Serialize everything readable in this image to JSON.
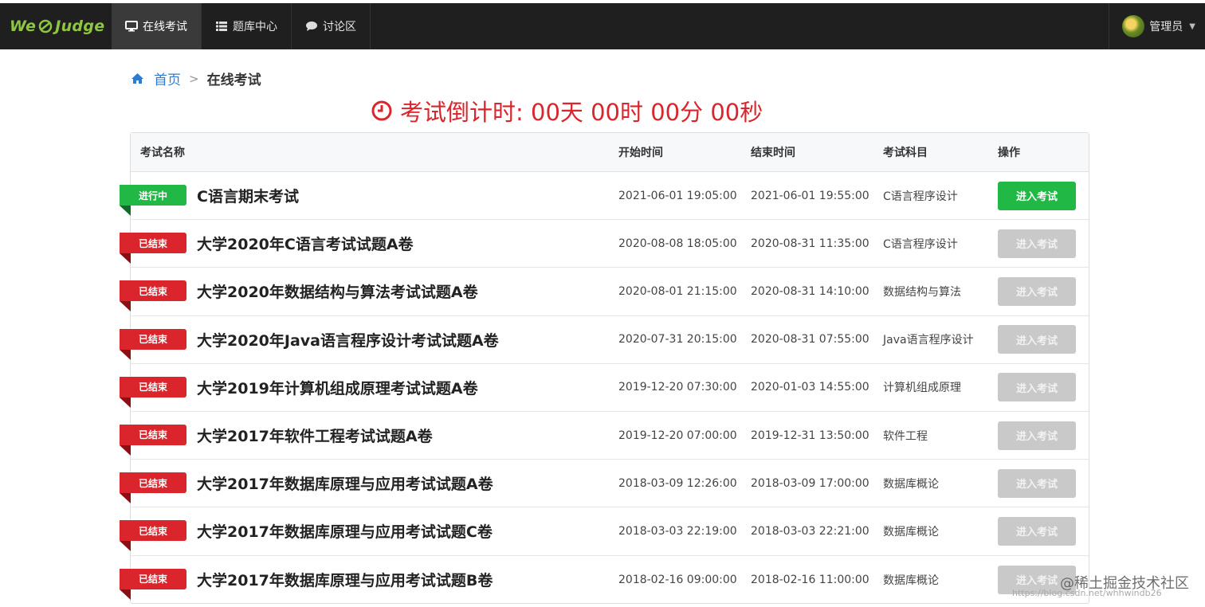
{
  "navbar": {
    "brand_left": "We",
    "brand_right": "Judge",
    "items": [
      {
        "label": "在线考试",
        "icon": "monitor-icon"
      },
      {
        "label": "题库中心",
        "icon": "list-icon"
      },
      {
        "label": "讨论区",
        "icon": "comment-icon"
      }
    ],
    "user": "管理员"
  },
  "breadcrumb": {
    "home": "首页",
    "current": "在线考试"
  },
  "countdown": {
    "text": "考试倒计时: 00天 00时 00分 00秒"
  },
  "table": {
    "headers": {
      "name": "考试名称",
      "start": "开始时间",
      "end": "结束时间",
      "subject": "考试科目",
      "op": "操作"
    },
    "rows": [
      {
        "status": "进行中",
        "name": "C语言期末考试",
        "start": "2021-06-01 19:05:00",
        "end": "2021-06-01 19:55:00",
        "subject": "C语言程序设计",
        "action": "进入考试"
      },
      {
        "status": "已结束",
        "name": "大学2020年C语言考试试题A卷",
        "start": "2020-08-08 18:05:00",
        "end": "2020-08-31 11:35:00",
        "subject": "C语言程序设计",
        "action": "进入考试"
      },
      {
        "status": "已结束",
        "name": "大学2020年数据结构与算法考试试题A卷",
        "start": "2020-08-01 21:15:00",
        "end": "2020-08-31 14:10:00",
        "subject": "数据结构与算法",
        "action": "进入考试"
      },
      {
        "status": "已结束",
        "name": "大学2020年Java语言程序设计考试试题A卷",
        "start": "2020-07-31 20:15:00",
        "end": "2020-08-31 07:55:00",
        "subject": "Java语言程序设计",
        "action": "进入考试"
      },
      {
        "status": "已结束",
        "name": "大学2019年计算机组成原理考试试题A卷",
        "start": "2019-12-20 07:30:00",
        "end": "2020-01-03 14:55:00",
        "subject": "计算机组成原理",
        "action": "进入考试"
      },
      {
        "status": "已结束",
        "name": "大学2017年软件工程考试试题A卷",
        "start": "2019-12-20 07:00:00",
        "end": "2019-12-31 13:50:00",
        "subject": "软件工程",
        "action": "进入考试"
      },
      {
        "status": "已结束",
        "name": "大学2017年数据库原理与应用考试试题A卷",
        "start": "2018-03-09 12:26:00",
        "end": "2018-03-09 17:00:00",
        "subject": "数据库概论",
        "action": "进入考试"
      },
      {
        "status": "已结束",
        "name": "大学2017年数据库原理与应用考试试题C卷",
        "start": "2018-03-03 22:19:00",
        "end": "2018-03-03 22:21:00",
        "subject": "数据库概论",
        "action": "进入考试"
      },
      {
        "status": "已结束",
        "name": "大学2017年数据库原理与应用考试试题B卷",
        "start": "2018-02-16 09:00:00",
        "end": "2018-02-16 11:00:00",
        "subject": "数据库概论",
        "action": "进入考试"
      }
    ]
  },
  "colors": {
    "navbar_bg": "#1f1f1f",
    "brand": "#8dc63f",
    "link": "#2e7bd0",
    "countdown": "#d9252b",
    "running": "#22b845",
    "ended": "#d9252b",
    "disabled_button": "#c9c9c9"
  },
  "watermark": {
    "main": "@稀土掘金技术社区",
    "sub": "https://blog.csdn.net/whhwindb26"
  }
}
